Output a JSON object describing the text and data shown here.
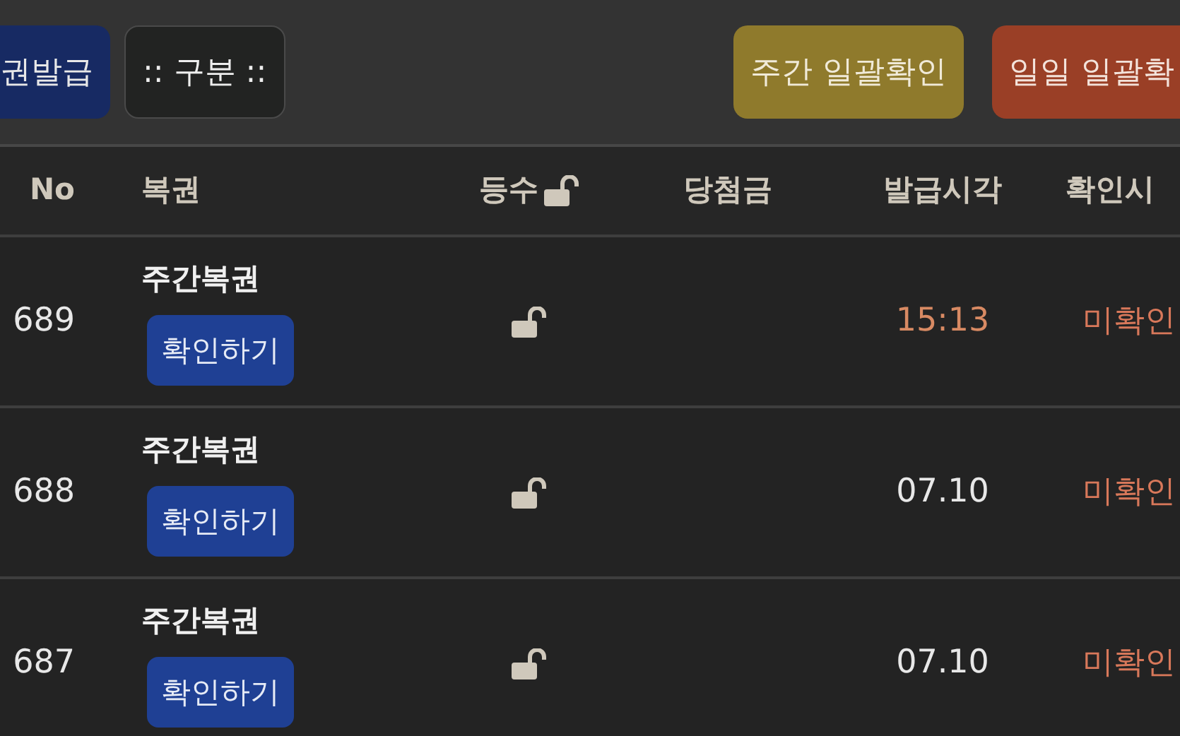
{
  "toolbar": {
    "left_buttons": [
      {
        "label": "권발급",
        "kind": "primary"
      },
      {
        "label": ":: 구분 ::",
        "kind": "outline"
      }
    ],
    "right_buttons": [
      {
        "label": "주간 일괄확인",
        "kind": "weekly"
      },
      {
        "label": "일일 일괄확",
        "kind": "daily"
      }
    ]
  },
  "table": {
    "columns": [
      "No",
      "복권",
      "등수",
      "당첨금",
      "발급시각",
      "확인시"
    ],
    "rows": [
      {
        "no": "689",
        "ticket": "주간복권",
        "action": "확인하기",
        "issued": "15:13",
        "today": true,
        "status": "미확인"
      },
      {
        "no": "688",
        "ticket": "주간복권",
        "action": "확인하기",
        "issued": "07.10",
        "today": false,
        "status": "미확인"
      },
      {
        "no": "687",
        "ticket": "주간복권",
        "action": "확인하기",
        "issued": "07.10",
        "today": false,
        "status": "미확인"
      }
    ]
  }
}
